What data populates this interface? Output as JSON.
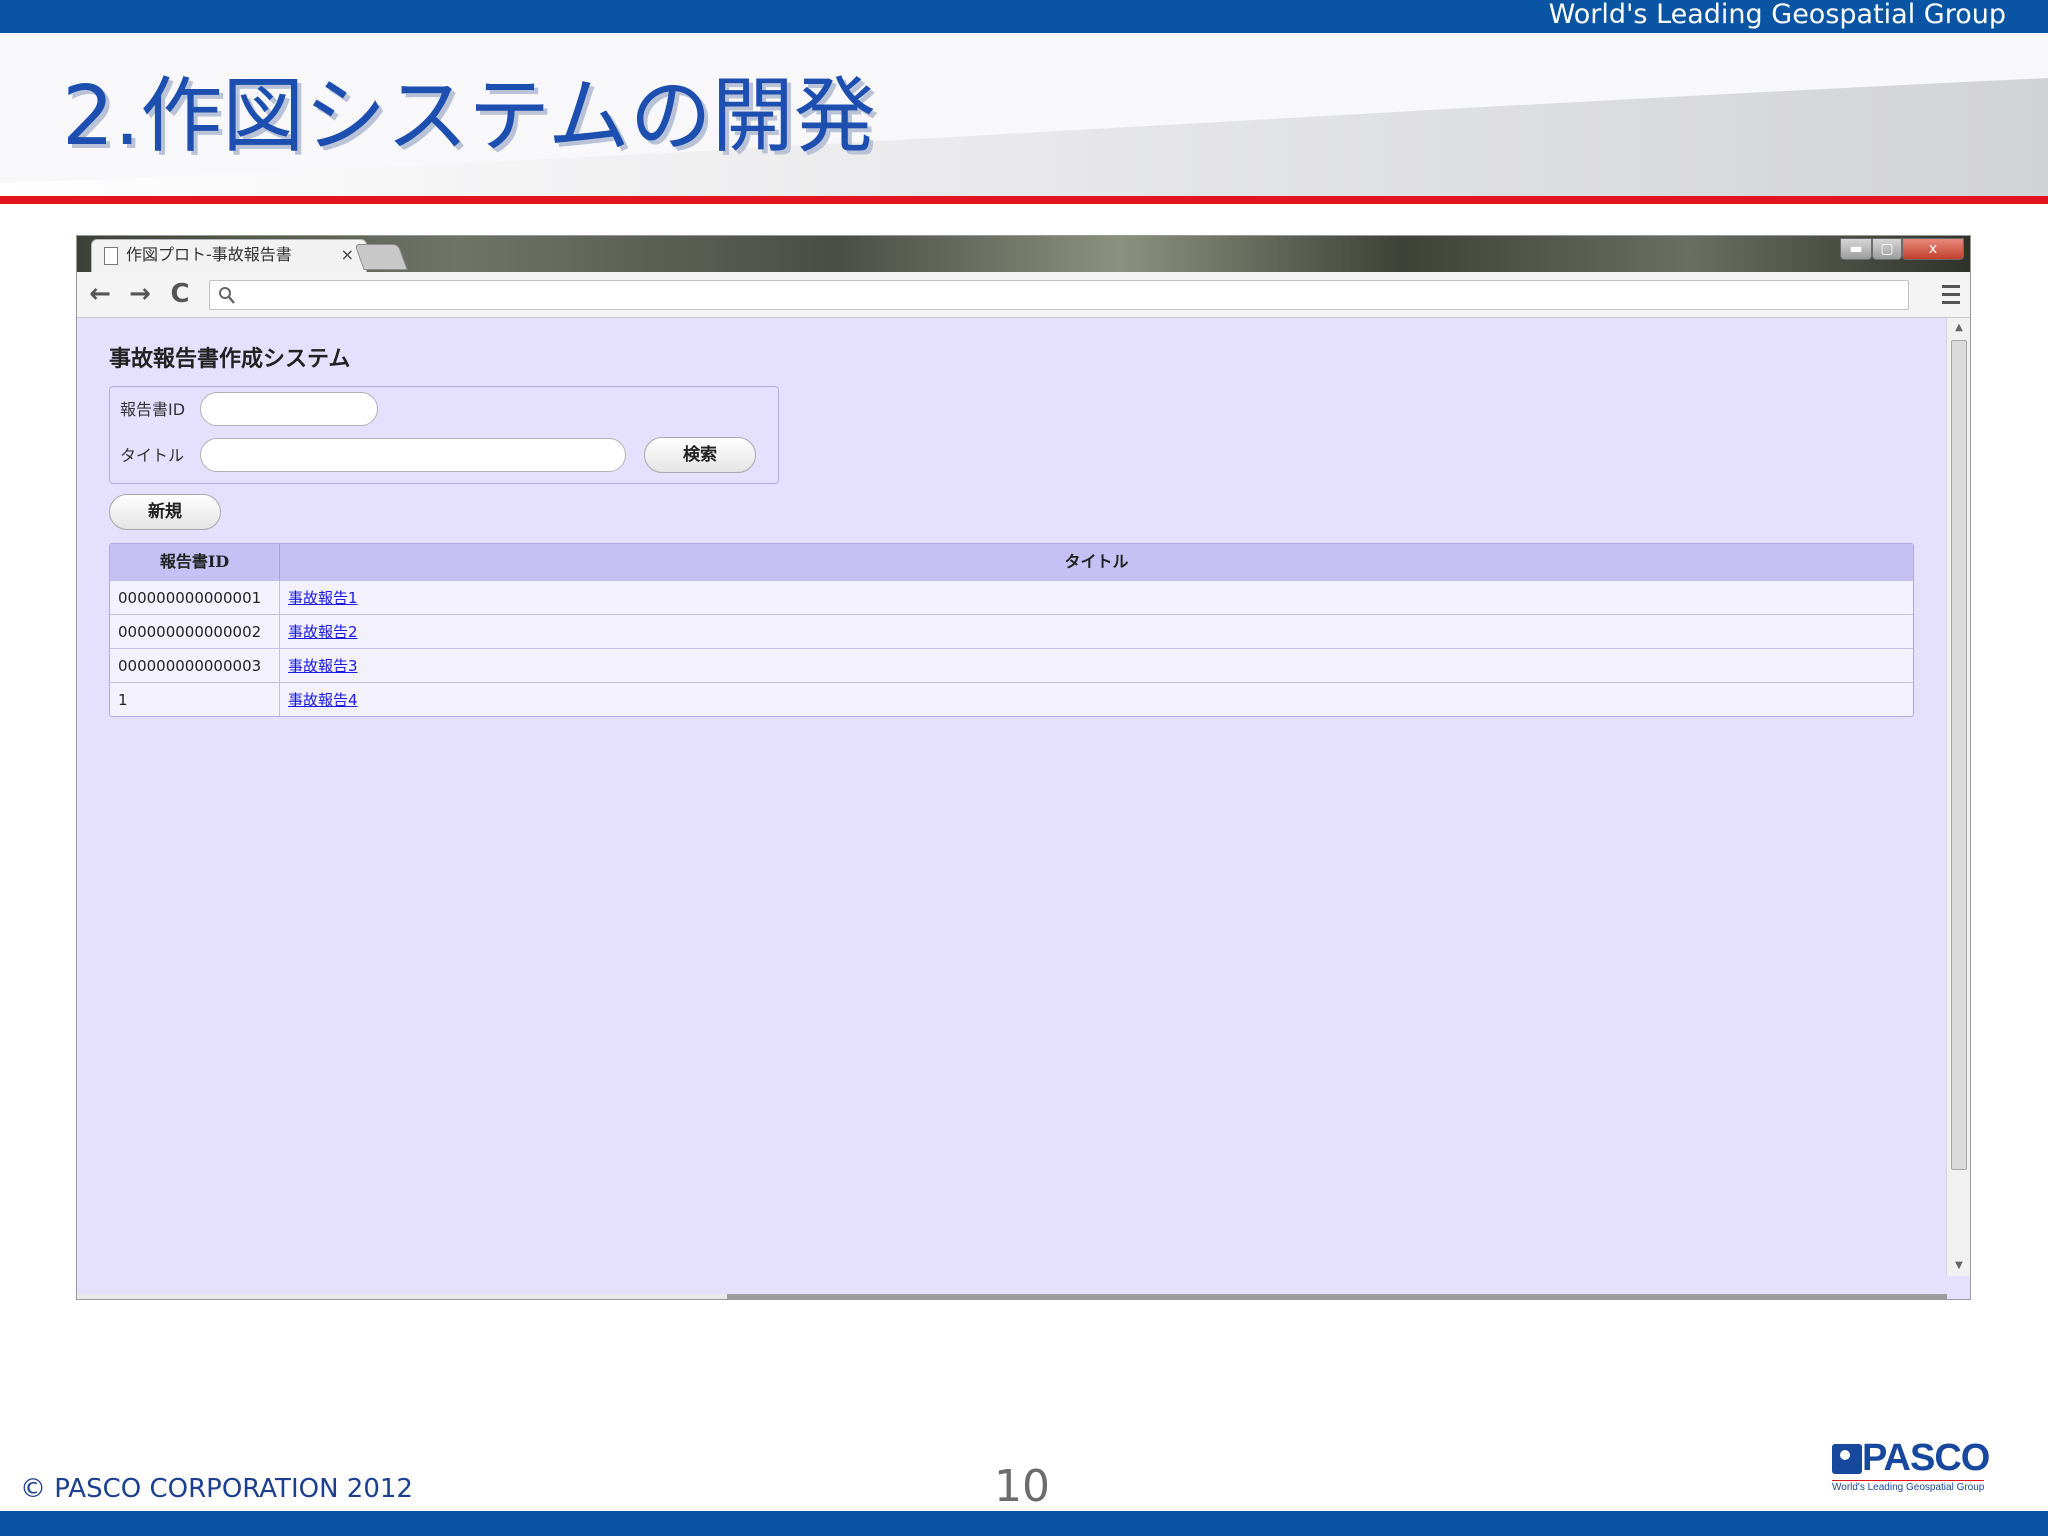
{
  "slide": {
    "tagline": "World's Leading Geospatial Group",
    "title_number": "2.",
    "title_text": "作図システムの開発",
    "copyright": "© PASCO CORPORATION 2012",
    "page_number": "10",
    "logo_name": "PASCO",
    "logo_tagline": "World's Leading Geospatial Group",
    "colors": {
      "brand_blue": "#0a55a3",
      "accent_red": "#e2141f",
      "page_bg": "#e6e0ff",
      "grid_header": "#c7c0f5"
    }
  },
  "browser": {
    "tab_label": "作図プロト-事故報告書",
    "tab_close": "×",
    "window_min": "▬",
    "window_max": "▢",
    "window_close": "x",
    "nav_back": "←",
    "nav_forward": "→",
    "nav_reload": "C",
    "address_value": ""
  },
  "app": {
    "title": "事故報告書作成システム",
    "search": {
      "id_label": "報告書ID",
      "id_value": "",
      "title_label": "タイトル",
      "title_value": "",
      "search_button": "検索"
    },
    "new_button": "新規",
    "table": {
      "columns": [
        "報告書ID",
        "タイトル"
      ],
      "rows": [
        {
          "id": "000000000000001",
          "title": "事故報告1"
        },
        {
          "id": "000000000000002",
          "title": "事故報告2"
        },
        {
          "id": "000000000000003",
          "title": "事故報告3"
        },
        {
          "id": "1",
          "title": "事故報告4"
        }
      ]
    }
  }
}
